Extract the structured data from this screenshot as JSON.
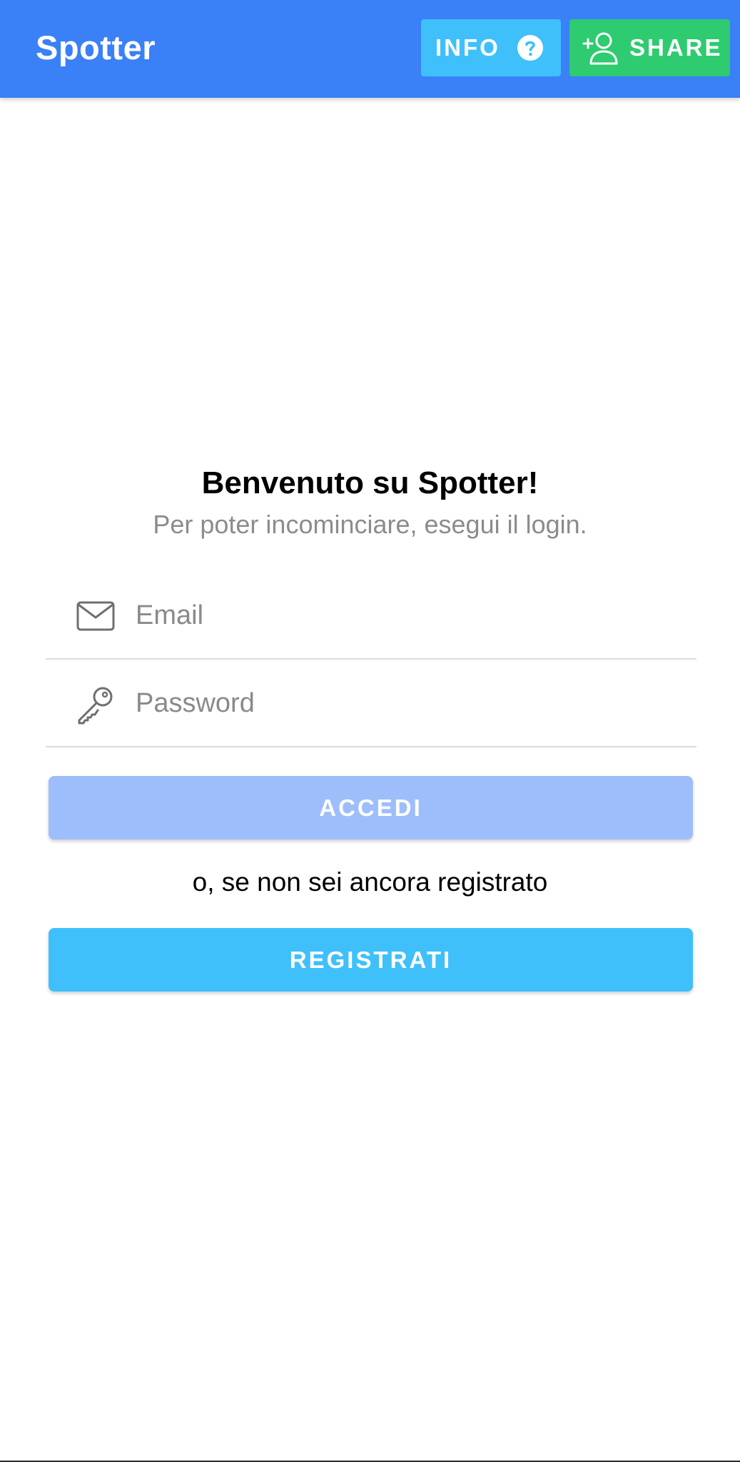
{
  "toolbar": {
    "title": "Spotter",
    "info_label": "INFO",
    "share_label": "SHARE",
    "info_icon": "help-circle-icon",
    "share_icon": "add-user-icon"
  },
  "welcome": {
    "title": "Benvenuto su Spotter!",
    "subtitle": "Per poter incominciare, esegui il login."
  },
  "form": {
    "email": {
      "placeholder": "Email",
      "value": "",
      "icon": "mail-icon"
    },
    "password": {
      "placeholder": "Password",
      "value": "",
      "icon": "key-icon"
    },
    "login_label": "ACCEDI",
    "alt_text": "o, se non sei ancora registrato",
    "register_label": "REGISTRATI"
  },
  "colors": {
    "toolbar": "#3a80f7",
    "info_button": "#3fc0fb",
    "share_button": "#2ecb71",
    "login_button_disabled": "#9dbefb",
    "register_button": "#3fc0fb",
    "subtitle_text": "#8c8c8c"
  }
}
